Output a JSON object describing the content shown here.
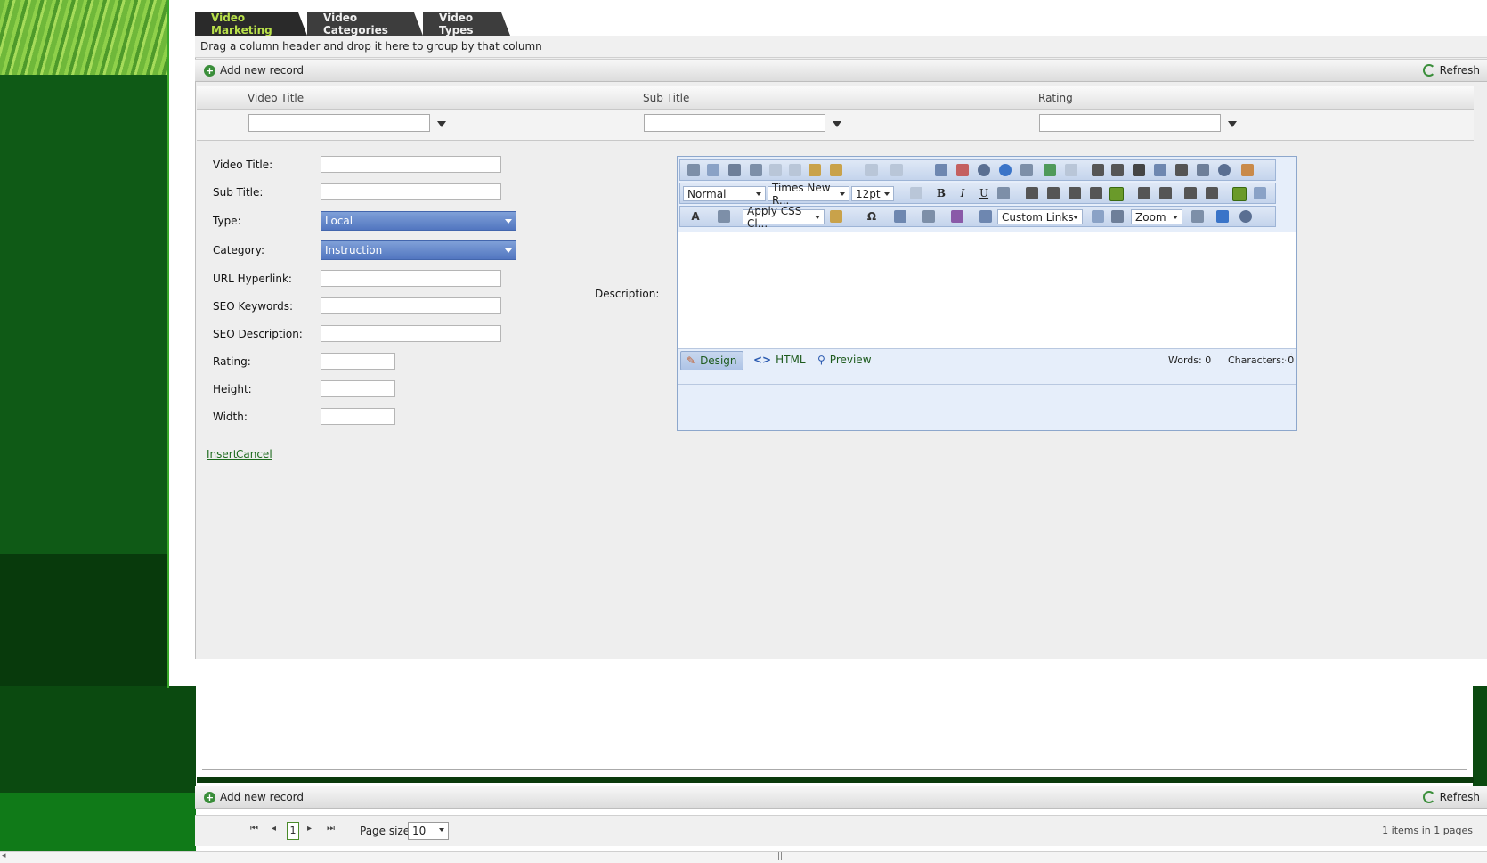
{
  "tabs": [
    {
      "label": "Video Marketing",
      "active": true
    },
    {
      "label": "Video Categories",
      "active": false
    },
    {
      "label": "Video Types",
      "active": false
    }
  ],
  "grid": {
    "group_hint": "Drag a column header and drop it here to group by that column",
    "add_new_label": "Add new record",
    "refresh_label": "Refresh",
    "columns": [
      "Video Title",
      "Sub Title",
      "Rating"
    ]
  },
  "form": {
    "video_title_label": "Video Title:",
    "sub_title_label": "Sub Title:",
    "type_label": "Type:",
    "type_value": "Local",
    "category_label": "Category:",
    "category_value": "Instruction",
    "url_label": "URL Hyperlink:",
    "seo_keywords_label": "SEO Keywords:",
    "seo_description_label": "SEO Description:",
    "rating_label": "Rating:",
    "height_label": "Height:",
    "width_label": "Width:",
    "description_label": "Description:",
    "insert_label": "Insert",
    "cancel_label": "Cancel"
  },
  "editor": {
    "paragraph_style": "Normal",
    "font_name": "Times New R...",
    "font_size": "12pt",
    "css_class": "Apply CSS Cl...",
    "custom_links": "Custom Links",
    "zoom": "Zoom",
    "modes": [
      "Design",
      "HTML",
      "Preview"
    ],
    "words": "Words: 0",
    "characters": "Characters: 0"
  },
  "pager": {
    "current_page": "1",
    "page_size_label": "Page size:",
    "page_size_value": "10",
    "summary_count": "1",
    "summary_items": "items in",
    "summary_pages_count": "1",
    "summary_pages": "pages"
  },
  "colors": {
    "active_tab_text": "#b8e04a",
    "combo_blue": "#5276c0",
    "link_green": "#1d6b1d",
    "sidebar_green": "#0f5a16"
  }
}
